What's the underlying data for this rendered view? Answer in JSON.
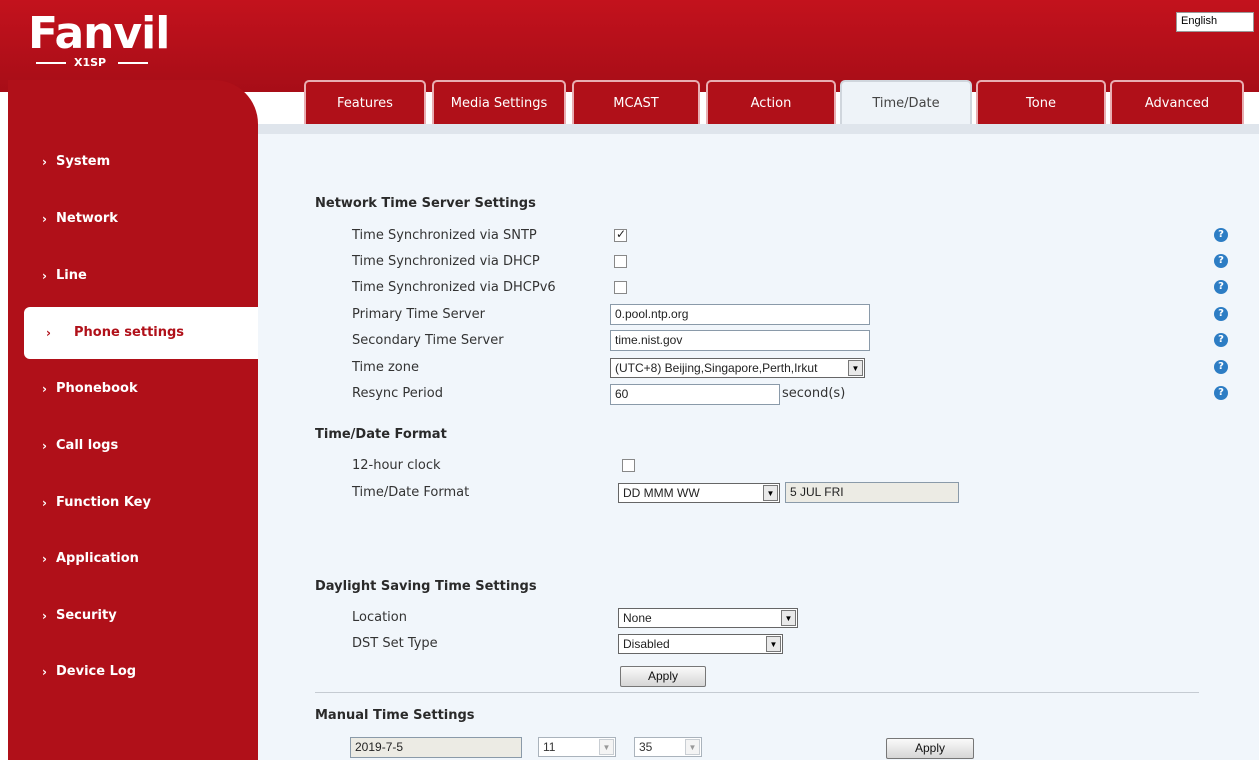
{
  "header": {
    "brand": "Fanvil",
    "model": "X1SP",
    "language": "English"
  },
  "sidebar": {
    "items": [
      {
        "label": "System"
      },
      {
        "label": "Network"
      },
      {
        "label": "Line"
      },
      {
        "label": "Phone settings",
        "active": true
      },
      {
        "label": "Phonebook"
      },
      {
        "label": "Call logs"
      },
      {
        "label": "Function Key"
      },
      {
        "label": "Application"
      },
      {
        "label": "Security"
      },
      {
        "label": "Device Log"
      }
    ]
  },
  "tabs": [
    {
      "label": "Features"
    },
    {
      "label": "Media Settings"
    },
    {
      "label": "MCAST"
    },
    {
      "label": "Action"
    },
    {
      "label": "Time/Date",
      "active": true
    },
    {
      "label": "Tone"
    },
    {
      "label": "Advanced"
    }
  ],
  "network_time": {
    "title": "Network Time Server Settings",
    "sntp_label": "Time Synchronized via SNTP",
    "sntp_checked": true,
    "dhcp_label": "Time Synchronized via DHCP",
    "dhcp_checked": false,
    "dhcpv6_label": "Time Synchronized via DHCPv6",
    "dhcpv6_checked": false,
    "primary_label": "Primary Time Server",
    "primary_value": "0.pool.ntp.org",
    "secondary_label": "Secondary Time Server",
    "secondary_value": "time.nist.gov",
    "timezone_label": "Time zone",
    "timezone_value": "(UTC+8) Beijing,Singapore,Perth,Irkut",
    "resync_label": "Resync Period",
    "resync_value": "60",
    "resync_unit": "second(s)"
  },
  "time_format": {
    "title": "Time/Date Format",
    "clock12_label": "12-hour clock",
    "clock12_checked": false,
    "format_label": "Time/Date Format",
    "format_value": "DD MMM WW",
    "preview": "5 JUL FRI"
  },
  "dst": {
    "title": "Daylight Saving Time Settings",
    "location_label": "Location",
    "location_value": "None",
    "type_label": "DST Set Type",
    "type_value": "Disabled",
    "apply_label": "Apply"
  },
  "manual_time": {
    "title": "Manual Time Settings",
    "date_value": "2019-7-5",
    "hour_value": "11",
    "minute_value": "35",
    "apply_label": "Apply"
  },
  "help_icon": "?"
}
